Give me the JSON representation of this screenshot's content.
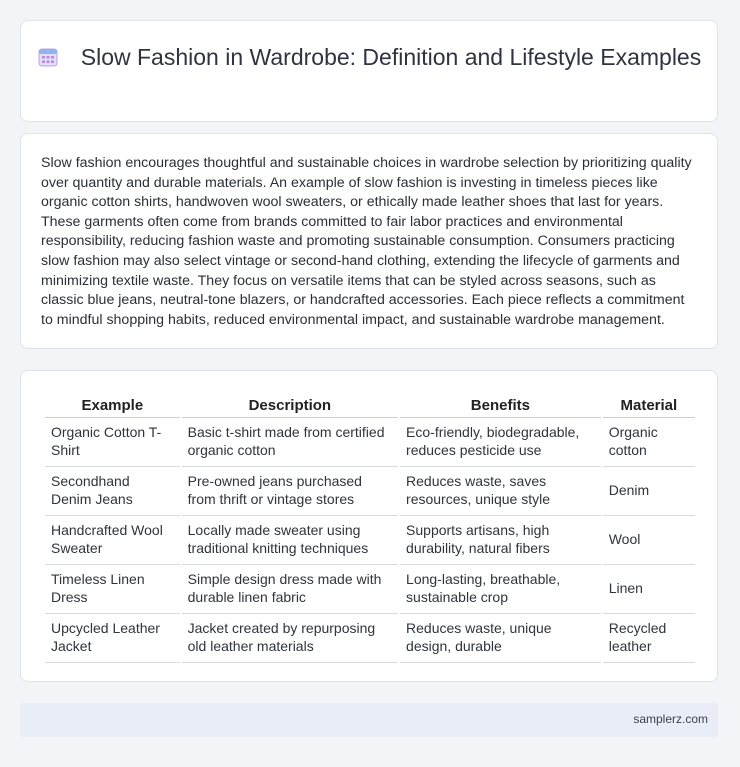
{
  "header": {
    "title": "Slow Fashion in Wardrobe: Definition and Lifestyle Examples",
    "icon": "calendar-icon"
  },
  "intro": {
    "text": "Slow fashion encourages thoughtful and sustainable choices in wardrobe selection by prioritizing quality over quantity and durable materials. An example of slow fashion is investing in timeless pieces like organic cotton shirts, handwoven wool sweaters, or ethically made leather shoes that last for years. These garments often come from brands committed to fair labor practices and environmental responsibility, reducing fashion waste and promoting sustainable consumption. Consumers practicing slow fashion may also select vintage or second-hand clothing, extending the lifecycle of garments and minimizing textile waste. They focus on versatile items that can be styled across seasons, such as classic blue jeans, neutral-tone blazers, or handcrafted accessories. Each piece reflects a commitment to mindful shopping habits, reduced environmental impact, and sustainable wardrobe management."
  },
  "table": {
    "headers": [
      "Example",
      "Description",
      "Benefits",
      "Material"
    ],
    "rows": [
      [
        "Organic Cotton T-Shirt",
        "Basic t-shirt made from certified organic cotton",
        "Eco-friendly, biodegradable, reduces pesticide use",
        "Organic cotton"
      ],
      [
        "Secondhand Denim Jeans",
        "Pre-owned jeans purchased from thrift or vintage stores",
        "Reduces waste, saves resources, unique style",
        "Denim"
      ],
      [
        "Handcrafted Wool Sweater",
        "Locally made sweater using traditional knitting techniques",
        "Supports artisans, high durability, natural fibers",
        "Wool"
      ],
      [
        "Timeless Linen Dress",
        "Simple design dress made with durable linen fabric",
        "Long-lasting, breathable, sustainable crop",
        "Linen"
      ],
      [
        "Upcycled Leather Jacket",
        "Jacket created by repurposing old leather materials",
        "Reduces waste, unique design, durable",
        "Recycled leather"
      ]
    ]
  },
  "footer": {
    "site": "samplerz.com"
  }
}
